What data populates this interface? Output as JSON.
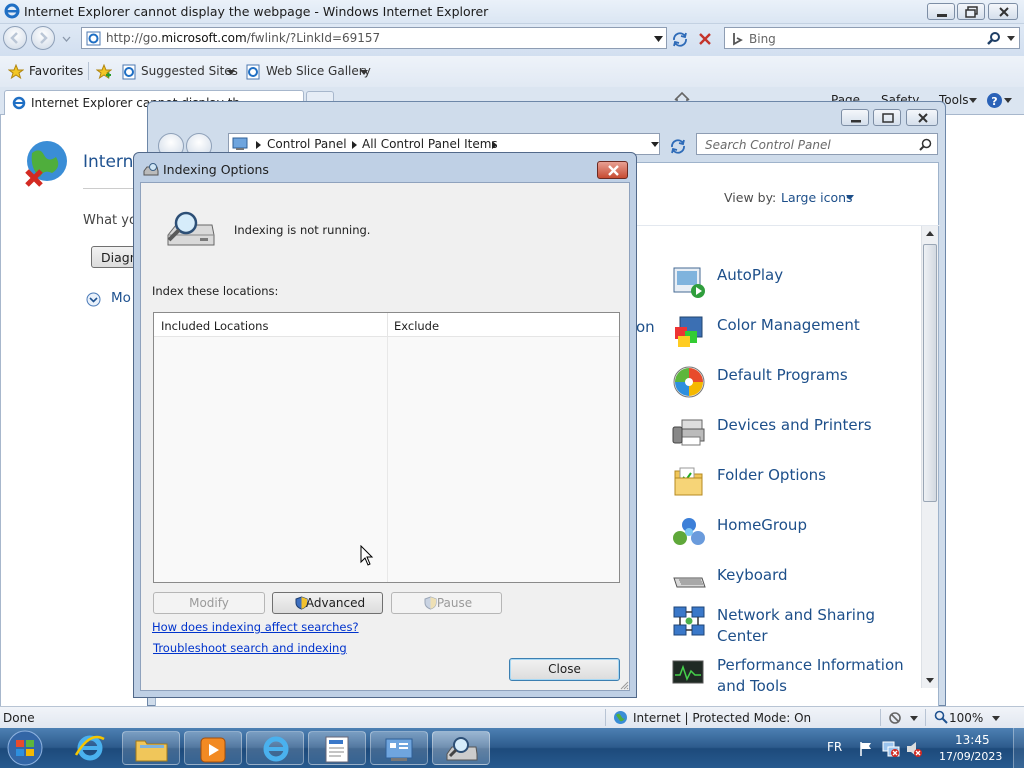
{
  "ie": {
    "window_title": "Internet Explorer cannot display the webpage - Windows Internet Explorer",
    "url_prefix": "http://go.",
    "url_domain": "microsoft.com",
    "url_suffix": "/fwlink/?LinkId=69157",
    "search_placeholder": "Bing",
    "favorites_label": "Favorites",
    "suggested_sites": "Suggested Sites",
    "web_slice_gallery": "Web Slice Gallery",
    "tab_title": "Internet Explorer cannot display the webpage",
    "cmd_page": "Page",
    "cmd_safety": "Safety",
    "cmd_tools": "Tools",
    "page_heading": "Interne",
    "page_question": "What yo",
    "diagnose_button": "Diagn",
    "more_info": "Mo",
    "status_text": "Done",
    "zone_text": "Internet | Protected Mode: On",
    "zoom_text": "100%"
  },
  "control_panel": {
    "breadcrumb": [
      "Control Panel",
      "All Control Panel Items"
    ],
    "search_placeholder": "Search Control Panel",
    "view_by_label": "View by:",
    "view_by_value": "Large icons",
    "partial_item": "on",
    "items": [
      {
        "label": "AutoPlay",
        "icon": "autoplay-icon"
      },
      {
        "label": "Color Management",
        "icon": "color-management-icon"
      },
      {
        "label": "Default Programs",
        "icon": "default-programs-icon"
      },
      {
        "label": "Devices and Printers",
        "icon": "devices-printers-icon"
      },
      {
        "label": "Folder Options",
        "icon": "folder-options-icon"
      },
      {
        "label": "HomeGroup",
        "icon": "homegroup-icon"
      },
      {
        "label": "Keyboard",
        "icon": "keyboard-icon"
      },
      {
        "label": "Network and Sharing Center",
        "icon": "network-sharing-icon"
      },
      {
        "label": "Performance Information and Tools",
        "icon": "performance-icon"
      }
    ]
  },
  "dialog": {
    "title": "Indexing Options",
    "status": "Indexing is not running.",
    "index_locations_label": "Index these locations:",
    "col_included": "Included Locations",
    "col_exclude": "Exclude",
    "modify": "Modify",
    "advanced": "Advanced",
    "pause": "Pause",
    "link_how": "How does indexing affect searches?",
    "link_troubleshoot": "Troubleshoot search and indexing",
    "close": "Close"
  },
  "taskbar": {
    "language": "FR",
    "time": "13:45",
    "date": "17/09/2023"
  }
}
